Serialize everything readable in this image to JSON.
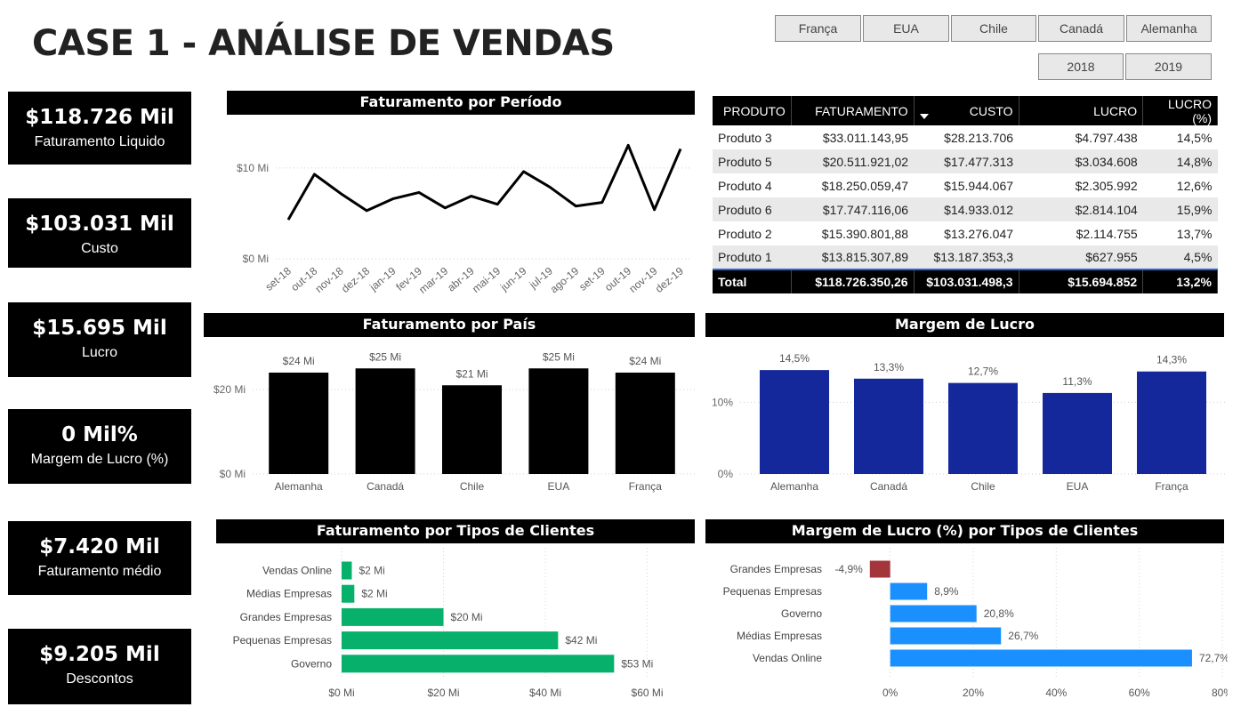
{
  "page": {
    "title": "CASE 1 - ANÁLISE DE VENDAS"
  },
  "slicers": {
    "countries": [
      "França",
      "EUA",
      "Chile",
      "Canadá",
      "Alemanha"
    ],
    "years": [
      "2018",
      "2019"
    ]
  },
  "cards": [
    {
      "value": "$118.726 Mil",
      "label": "Faturamento Liquido"
    },
    {
      "value": "$103.031 Mil",
      "label": "Custo"
    },
    {
      "value": "$15.695 Mil",
      "label": "Lucro"
    },
    {
      "value": "0 Mil%",
      "label": "Margem de Lucro (%)"
    },
    {
      "value": "$7.420 Mil",
      "label": "Faturamento médio"
    },
    {
      "value": "$9.205 Mil",
      "label": "Descontos"
    }
  ],
  "colors": {
    "black": "#000000",
    "blue_bar": "#14279b",
    "green_bar": "#07b06b",
    "neg_bar": "#a4353a",
    "pos_bar": "#1a90ff",
    "sort_icon": "#ffffff"
  },
  "table": {
    "columns": [
      "PRODUTO",
      "FATURAMENTO",
      "CUSTO",
      "LUCRO",
      "LUCRO (%)"
    ],
    "sort_icon": "sort-down-icon",
    "rows": [
      [
        "Produto 3",
        "$33.011.143,95",
        "$28.213.706",
        "$4.797.438",
        "14,5%"
      ],
      [
        "Produto 5",
        "$20.511.921,02",
        "$17.477.313",
        "$3.034.608",
        "14,8%"
      ],
      [
        "Produto 4",
        "$18.250.059,47",
        "$15.944.067",
        "$2.305.992",
        "12,6%"
      ],
      [
        "Produto 6",
        "$17.747.116,06",
        "$14.933.012",
        "$2.814.104",
        "15,9%"
      ],
      [
        "Produto 2",
        "$15.390.801,88",
        "$13.276.047",
        "$2.114.755",
        "13,7%"
      ],
      [
        "Produto 1",
        "$13.815.307,89",
        "$13.187.353,3",
        "$627.955",
        "4,5%"
      ]
    ],
    "total": [
      "Total",
      "$118.726.350,26",
      "$103.031.498,3",
      "$15.694.852",
      "13,2%"
    ]
  },
  "chart_data": [
    {
      "id": "period",
      "type": "line",
      "title": "Faturamento por Período",
      "x": [
        "set-18",
        "out-18",
        "nov-18",
        "dez-18",
        "jan-19",
        "fev-19",
        "mar-19",
        "abr-19",
        "mai-19",
        "jun-19",
        "jul-19",
        "ago-19",
        "set-19",
        "out-19",
        "nov-19",
        "dez-19"
      ],
      "values": [
        4.3,
        9.3,
        7.2,
        5.3,
        6.6,
        7.3,
        5.6,
        6.9,
        6.0,
        9.6,
        7.9,
        5.8,
        6.2,
        12.5,
        5.4,
        12.1
      ],
      "y_ticks": [
        {
          "v": 0,
          "label": "$0 Mi"
        },
        {
          "v": 10,
          "label": "$10 Mi"
        }
      ],
      "ylim": [
        0,
        14
      ],
      "grid": true
    },
    {
      "id": "country",
      "type": "bar",
      "title": "Faturamento por País",
      "categories": [
        "Alemanha",
        "Canadá",
        "Chile",
        "EUA",
        "França"
      ],
      "values": [
        24,
        25,
        21,
        25,
        24
      ],
      "data_labels": [
        "$24 Mi",
        "$25 Mi",
        "$21 Mi",
        "$25 Mi",
        "$24 Mi"
      ],
      "y_ticks": [
        {
          "v": 0,
          "label": "$0 Mi"
        },
        {
          "v": 20,
          "label": "$20 Mi"
        }
      ],
      "ylim": [
        0,
        28
      ],
      "grid": true
    },
    {
      "id": "margin",
      "type": "bar",
      "title": "Margem de Lucro",
      "categories": [
        "Alemanha",
        "Canadá",
        "Chile",
        "EUA",
        "França"
      ],
      "values": [
        14.5,
        13.3,
        12.7,
        11.3,
        14.3
      ],
      "data_labels": [
        "14,5%",
        "13,3%",
        "12,7%",
        "11,3%",
        "14,3%"
      ],
      "y_ticks": [
        {
          "v": 0,
          "label": "0%"
        },
        {
          "v": 10,
          "label": "10%"
        }
      ],
      "ylim": [
        0,
        16.5
      ],
      "grid": true
    },
    {
      "id": "clients",
      "type": "bar",
      "orientation": "horizontal",
      "title": "Faturamento por Tipos de Clientes",
      "categories": [
        "Vendas Online",
        "Médias Empresas",
        "Grandes Empresas",
        "Pequenas Empresas",
        "Governo"
      ],
      "values": [
        2,
        2.5,
        20,
        42.5,
        53.5
      ],
      "data_labels": [
        "$2 Mi",
        "$2 Mi",
        "$20 Mi",
        "$42 Mi",
        "$53 Mi"
      ],
      "x_ticks": [
        {
          "v": 0,
          "label": "$0 Mi"
        },
        {
          "v": 20,
          "label": "$20 Mi"
        },
        {
          "v": 40,
          "label": "$40 Mi"
        },
        {
          "v": 60,
          "label": "$60 Mi"
        }
      ],
      "xlim": [
        0,
        62
      ],
      "grid": true
    },
    {
      "id": "margin_clients",
      "type": "bar",
      "orientation": "horizontal",
      "title": "Margem de Lucro (%) por Tipos de Clientes",
      "categories": [
        "Grandes Empresas",
        "Pequenas Empresas",
        "Governo",
        "Médias Empresas",
        "Vendas Online"
      ],
      "values": [
        -4.9,
        8.9,
        20.8,
        26.7,
        72.7
      ],
      "data_labels": [
        "-4,9%",
        "8,9%",
        "20,8%",
        "26,7%",
        "72,7%"
      ],
      "x_ticks": [
        {
          "v": 0,
          "label": "0%"
        },
        {
          "v": 20,
          "label": "20%"
        },
        {
          "v": 40,
          "label": "40%"
        },
        {
          "v": 60,
          "label": "60%"
        },
        {
          "v": 80,
          "label": "80%"
        }
      ],
      "xlim": [
        -10,
        80
      ],
      "grid": true
    }
  ]
}
